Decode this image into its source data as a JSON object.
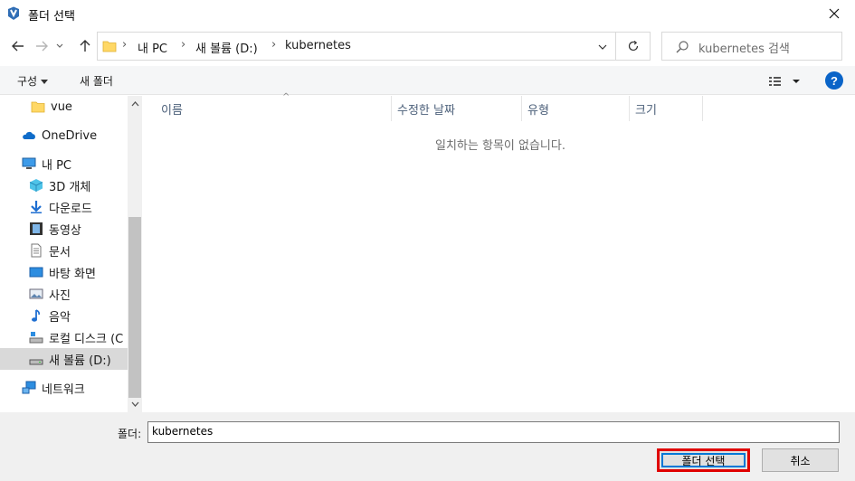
{
  "window": {
    "title": "폴더 선택"
  },
  "address": {
    "crumbs": [
      "내 PC",
      "새 볼륨 (D:)",
      "kubernetes"
    ]
  },
  "search": {
    "placeholder": "kubernetes 검색"
  },
  "toolbar": {
    "organize": "구성",
    "new_folder": "새 폴더",
    "help": "?"
  },
  "nav": {
    "items": [
      {
        "label": "vue",
        "icon": "folder-icon"
      },
      {
        "label": "OneDrive",
        "icon": "cloud-icon"
      },
      {
        "label": "내 PC",
        "icon": "computer-icon"
      },
      {
        "label": "3D 개체",
        "icon": "cube-icon"
      },
      {
        "label": "다운로드",
        "icon": "download-icon"
      },
      {
        "label": "동영상",
        "icon": "video-icon"
      },
      {
        "label": "문서",
        "icon": "document-icon"
      },
      {
        "label": "바탕 화면",
        "icon": "desktop-icon"
      },
      {
        "label": "사진",
        "icon": "picture-icon"
      },
      {
        "label": "음악",
        "icon": "music-icon"
      },
      {
        "label": "로컬 디스크 (C",
        "icon": "drive-icon"
      },
      {
        "label": "새 볼륨 (D:)",
        "icon": "drive-icon"
      },
      {
        "label": "네트워크",
        "icon": "network-icon"
      }
    ]
  },
  "columns": [
    "이름",
    "수정한 날짜",
    "유형",
    "크기"
  ],
  "empty_message": "일치하는 항목이 없습니다.",
  "footer": {
    "folder_label": "폴더:",
    "folder_value": "kubernetes",
    "select_button": "폴더 선택",
    "cancel_button": "취소"
  },
  "colors": {
    "accent": "#0078d7",
    "highlight_border": "#e00000",
    "help": "#0a64c8"
  }
}
